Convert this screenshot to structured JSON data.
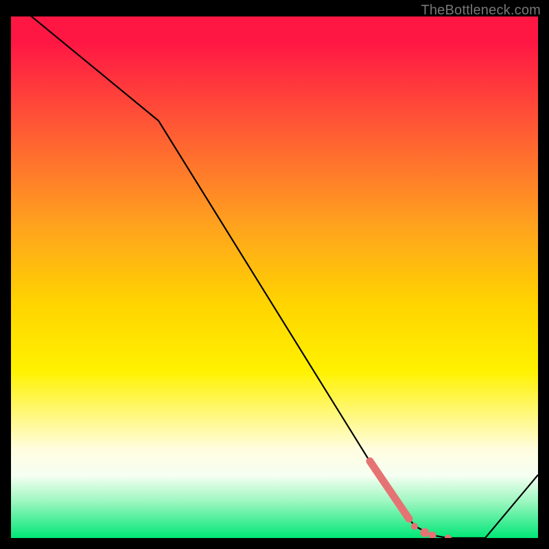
{
  "attribution": "TheBottleneck.com",
  "colors": {
    "line": "#000000",
    "marker_fill": "#e57373",
    "marker_stroke": "#d05858"
  },
  "chart_data": {
    "type": "line",
    "title": "",
    "xlabel": "",
    "ylabel": "",
    "xlim": [
      0,
      100
    ],
    "ylim": [
      0,
      100
    ],
    "x": [
      0,
      4,
      28,
      71,
      75,
      77,
      80,
      83,
      90,
      100
    ],
    "values": [
      104,
      100,
      80,
      10,
      4,
      2,
      0.5,
      0,
      0,
      12
    ],
    "markers": {
      "segment": {
        "x_start": 68,
        "x_end": 75,
        "note": "thick pink segment on line"
      },
      "points": [
        {
          "x": 76.5,
          "y": 2.2
        },
        {
          "x": 78.5,
          "y": 1.0
        },
        {
          "x": 80.0,
          "y": 0.5
        },
        {
          "x": 83.0,
          "y": 0.0
        }
      ]
    }
  }
}
